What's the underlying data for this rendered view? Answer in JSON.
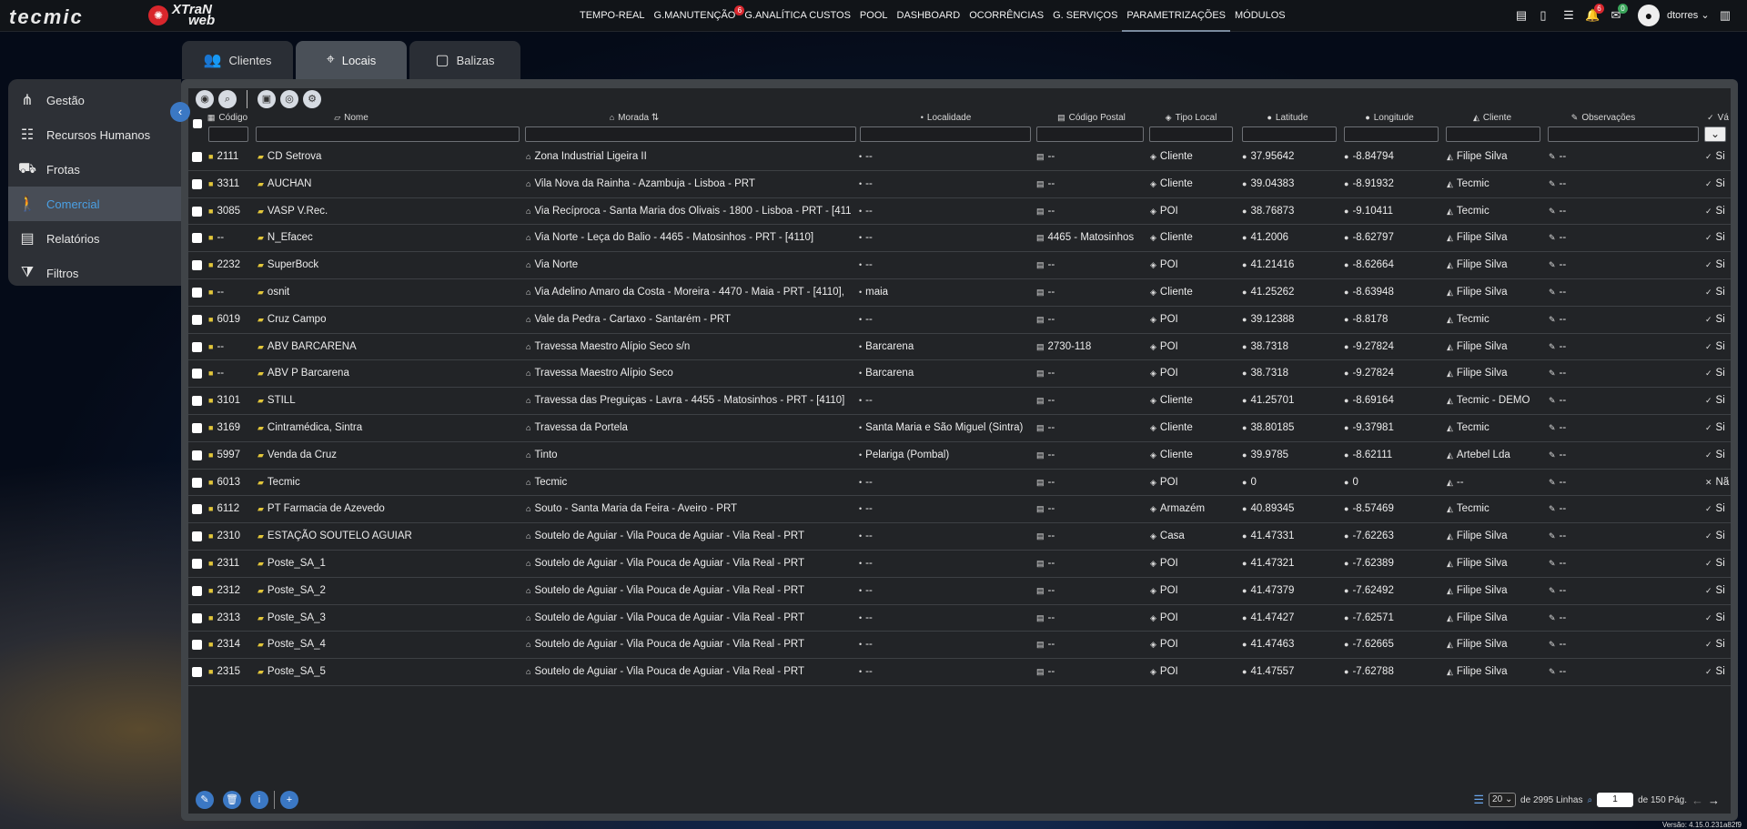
{
  "brand": {
    "logo_text": "tecmic",
    "product_line1": "XTraN",
    "product_line2": "web"
  },
  "nav": [
    {
      "label": "TEMPO-REAL"
    },
    {
      "label": "G.MANUTENÇÃO",
      "badge": "6"
    },
    {
      "label": "G.ANALÍTICA CUSTOS"
    },
    {
      "label": "POOL"
    },
    {
      "label": "DASHBOARD"
    },
    {
      "label": "OCORRÊNCIAS"
    },
    {
      "label": "G. SERVIÇOS"
    },
    {
      "label": "PARAMETRIZAÇÕES",
      "active": true
    },
    {
      "label": "MÓDULOS"
    }
  ],
  "topbar": {
    "notifications_badge": "6",
    "messages_badge": "0",
    "username": "dtorres"
  },
  "tabs": [
    {
      "label": "Clientes"
    },
    {
      "label": "Locais",
      "active": true
    },
    {
      "label": "Balizas"
    }
  ],
  "sidebar": [
    {
      "label": "Gestão",
      "icon": "hierarchy-icon"
    },
    {
      "label": "Recursos Humanos",
      "icon": "users-icon"
    },
    {
      "label": "Frotas",
      "icon": "vehicles-icon"
    },
    {
      "label": "Comercial",
      "icon": "walking-person-icon",
      "active": true
    },
    {
      "label": "Relatórios",
      "icon": "report-icon"
    },
    {
      "label": "Filtros",
      "icon": "filter-icon"
    }
  ],
  "columns": {
    "codigo": "Código",
    "nome": "Nome",
    "morada": "Morada",
    "localidade": "Localidade",
    "codigo_postal": "Código Postal",
    "tipo_local": "Tipo Local",
    "latitude": "Latitude",
    "longitude": "Longitude",
    "cliente": "Cliente",
    "observacoes": "Observações",
    "visivel": "Vá"
  },
  "rows": [
    {
      "codigo": "2111",
      "nome": "CD Setrova",
      "morada": "Zona Industrial Ligeira II",
      "localidade": "--",
      "codigo_postal": "--",
      "tipo": "Cliente",
      "lat": "37.95642",
      "lon": "-8.84794",
      "cliente": "Filipe Silva",
      "obs": "--",
      "vis": "Si"
    },
    {
      "codigo": "3311",
      "nome": "AUCHAN",
      "morada": "Vila Nova da Rainha - Azambuja - Lisboa - PRT",
      "localidade": "--",
      "codigo_postal": "--",
      "tipo": "Cliente",
      "lat": "39.04383",
      "lon": "-8.91932",
      "cliente": "Tecmic",
      "obs": "--",
      "vis": "Si"
    },
    {
      "codigo": "3085",
      "nome": "VASP V.Rec.",
      "morada": "Via Recíproca - Santa Maria dos Olivais - 1800 - Lisboa - PRT - [411",
      "localidade": "--",
      "codigo_postal": "--",
      "tipo": "POI",
      "lat": "38.76873",
      "lon": "-9.10411",
      "cliente": "Tecmic",
      "obs": "--",
      "vis": "Si"
    },
    {
      "codigo": "--",
      "nome": "N_Efacec",
      "morada": "Via Norte - Leça do Balio - 4465 - Matosinhos - PRT - [4110]",
      "localidade": "--",
      "codigo_postal": "4465 - Matosinhos",
      "tipo": "Cliente",
      "lat": "41.2006",
      "lon": "-8.62797",
      "cliente": "Filipe Silva",
      "obs": "--",
      "vis": "Si"
    },
    {
      "codigo": "2232",
      "nome": "SuperBock",
      "morada": "Via Norte",
      "localidade": "--",
      "codigo_postal": "--",
      "tipo": "POI",
      "lat": "41.21416",
      "lon": "-8.62664",
      "cliente": "Filipe Silva",
      "obs": "--",
      "vis": "Si"
    },
    {
      "codigo": "--",
      "nome": "osnit",
      "morada": "Via Adelino Amaro da Costa - Moreira - 4470 - Maia - PRT - [4110],",
      "localidade": "maia",
      "codigo_postal": "--",
      "tipo": "Cliente",
      "lat": "41.25262",
      "lon": "-8.63948",
      "cliente": "Filipe Silva",
      "obs": "--",
      "vis": "Si"
    },
    {
      "codigo": "6019",
      "nome": "Cruz Campo",
      "morada": "Vale da Pedra - Cartaxo - Santarém - PRT",
      "localidade": "--",
      "codigo_postal": "--",
      "tipo": "POI",
      "lat": "39.12388",
      "lon": "-8.8178",
      "cliente": "Tecmic",
      "obs": "--",
      "vis": "Si"
    },
    {
      "codigo": "--",
      "nome": "ABV BARCARENA",
      "morada": "Travessa Maestro Alípio Seco s/n",
      "localidade": "Barcarena",
      "codigo_postal": "2730-118",
      "tipo": "POI",
      "lat": "38.7318",
      "lon": "-9.27824",
      "cliente": "Filipe Silva",
      "obs": "--",
      "vis": "Si"
    },
    {
      "codigo": "--",
      "nome": "ABV P Barcarena",
      "morada": "Travessa Maestro Alípio Seco",
      "localidade": "Barcarena",
      "codigo_postal": "--",
      "tipo": "POI",
      "lat": "38.7318",
      "lon": "-9.27824",
      "cliente": "Filipe Silva",
      "obs": "--",
      "vis": "Si"
    },
    {
      "codigo": "3101",
      "nome": "STILL",
      "morada": "Travessa das Preguiças - Lavra - 4455 - Matosinhos - PRT - [4110]",
      "localidade": "--",
      "codigo_postal": "--",
      "tipo": "Cliente",
      "lat": "41.25701",
      "lon": "-8.69164",
      "cliente": "Tecmic - DEMO",
      "obs": "--",
      "vis": "Si"
    },
    {
      "codigo": "3169",
      "nome": "Cintramédica, Sintra",
      "morada": "Travessa da Portela",
      "localidade": "Santa Maria e São Miguel (Sintra)",
      "codigo_postal": "--",
      "tipo": "Cliente",
      "lat": "38.80185",
      "lon": "-9.37981",
      "cliente": "Tecmic",
      "obs": "--",
      "vis": "Si"
    },
    {
      "codigo": "5997",
      "nome": "Venda da Cruz",
      "morada": "Tinto",
      "localidade": "Pelariga (Pombal)",
      "codigo_postal": "--",
      "tipo": "Cliente",
      "lat": "39.9785",
      "lon": "-8.62111",
      "cliente": "Artebel Lda",
      "obs": "--",
      "vis": "Si"
    },
    {
      "codigo": "6013",
      "nome": "Tecmic",
      "morada": "Tecmic",
      "localidade": "--",
      "codigo_postal": "--",
      "tipo": "POI",
      "lat": "0",
      "lon": "0",
      "cliente": "--",
      "obs": "--",
      "vis": "Nã",
      "vis_no": true
    },
    {
      "codigo": "6112",
      "nome": "PT Farmacia de Azevedo",
      "morada": "Souto - Santa Maria da Feira - Aveiro - PRT",
      "localidade": "--",
      "codigo_postal": "--",
      "tipo": "Armazém",
      "lat": "40.89345",
      "lon": "-8.57469",
      "cliente": "Tecmic",
      "obs": "--",
      "vis": "Si"
    },
    {
      "codigo": "2310",
      "nome": "ESTAÇÃO SOUTELO AGUIAR",
      "morada": "Soutelo de Aguiar - Vila Pouca de Aguiar - Vila Real - PRT",
      "localidade": "--",
      "codigo_postal": "--",
      "tipo": "Casa",
      "lat": "41.47331",
      "lon": "-7.62263",
      "cliente": "Filipe Silva",
      "obs": "--",
      "vis": "Si"
    },
    {
      "codigo": "2311",
      "nome": "Poste_SA_1",
      "morada": "Soutelo de Aguiar - Vila Pouca de Aguiar - Vila Real - PRT",
      "localidade": "--",
      "codigo_postal": "--",
      "tipo": "POI",
      "lat": "41.47321",
      "lon": "-7.62389",
      "cliente": "Filipe Silva",
      "obs": "--",
      "vis": "Si"
    },
    {
      "codigo": "2312",
      "nome": "Poste_SA_2",
      "morada": "Soutelo de Aguiar - Vila Pouca de Aguiar - Vila Real - PRT",
      "localidade": "--",
      "codigo_postal": "--",
      "tipo": "POI",
      "lat": "41.47379",
      "lon": "-7.62492",
      "cliente": "Filipe Silva",
      "obs": "--",
      "vis": "Si"
    },
    {
      "codigo": "2313",
      "nome": "Poste_SA_3",
      "morada": "Soutelo de Aguiar - Vila Pouca de Aguiar - Vila Real - PRT",
      "localidade": "--",
      "codigo_postal": "--",
      "tipo": "POI",
      "lat": "41.47427",
      "lon": "-7.62571",
      "cliente": "Filipe Silva",
      "obs": "--",
      "vis": "Si"
    },
    {
      "codigo": "2314",
      "nome": "Poste_SA_4",
      "morada": "Soutelo de Aguiar - Vila Pouca de Aguiar - Vila Real - PRT",
      "localidade": "--",
      "codigo_postal": "--",
      "tipo": "POI",
      "lat": "41.47463",
      "lon": "-7.62665",
      "cliente": "Filipe Silva",
      "obs": "--",
      "vis": "Si"
    },
    {
      "codigo": "2315",
      "nome": "Poste_SA_5",
      "morada": "Soutelo de Aguiar - Vila Pouca de Aguiar - Vila Real - PRT",
      "localidade": "--",
      "codigo_postal": "--",
      "tipo": "POI",
      "lat": "41.47557",
      "lon": "-7.62788",
      "cliente": "Filipe Silva",
      "obs": "--",
      "vis": "Si"
    }
  ],
  "pagination": {
    "page_size": "20",
    "total_label": "de 2995 Linhas",
    "page": "1",
    "pages_label": "de 150 Pág."
  },
  "version": "Versão: 4.15.0.231a82f9"
}
